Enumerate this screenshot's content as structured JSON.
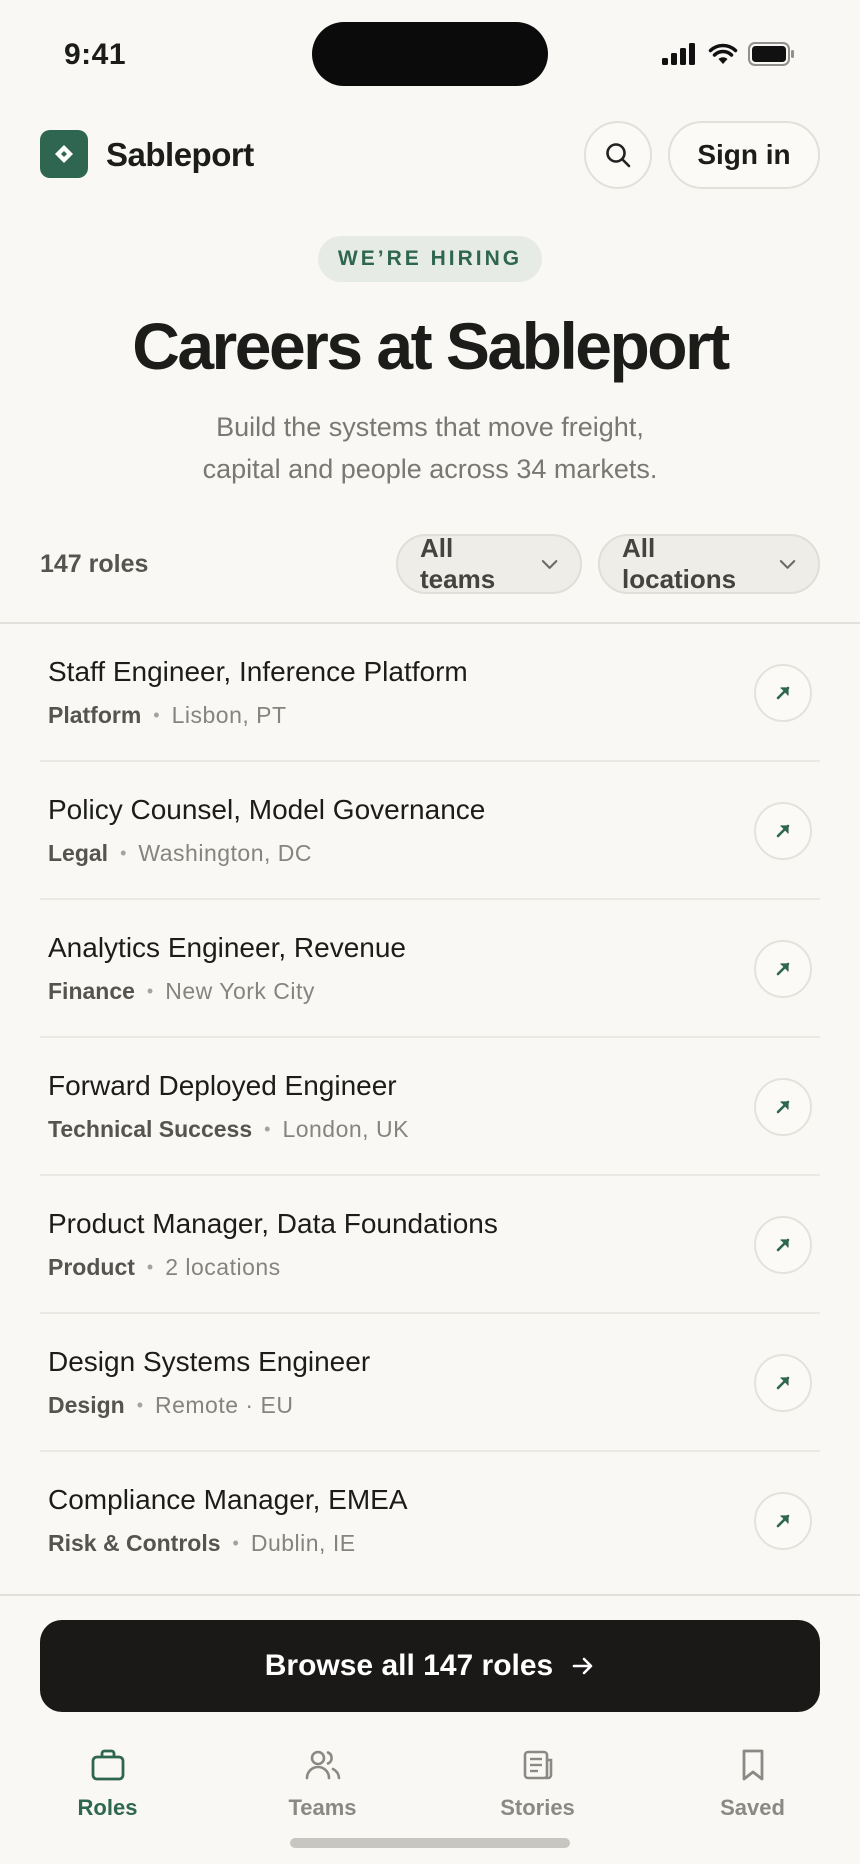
{
  "status_bar": {
    "time": "9:41"
  },
  "header": {
    "brand": "Sableport",
    "sign_in_label": "Sign in",
    "search_icon": "search-icon"
  },
  "hero": {
    "badge": "WE’RE HIRING",
    "title": "Careers at Sableport",
    "subtitle_line1": "Build the systems that move freight,",
    "subtitle_line2": "capital and people across 34 markets."
  },
  "filters": {
    "count": "147 roles",
    "teams": "All teams",
    "locations": "All locations"
  },
  "roles": [
    {
      "title": "Staff Engineer, Inference Platform",
      "team": "Platform",
      "location": "Lisbon, PT"
    },
    {
      "title": "Policy Counsel, Model Governance",
      "team": "Legal",
      "location": "Washington, DC"
    },
    {
      "title": "Analytics Engineer, Revenue",
      "team": "Finance",
      "location": "New York City"
    },
    {
      "title": "Forward Deployed Engineer",
      "team": "Technical Success",
      "location": "London, UK"
    },
    {
      "title": "Product Manager, Data Foundations",
      "team": "Product",
      "location": "2 locations"
    },
    {
      "title": "Design Systems Engineer",
      "team": "Design",
      "location": "Remote · EU"
    },
    {
      "title": "Compliance Manager, EMEA",
      "team": "Risk & Controls",
      "location": "Dublin, IE"
    }
  ],
  "cta": {
    "label": "Browse all 147 roles"
  },
  "tabs": [
    {
      "label": "Roles",
      "icon": "briefcase-icon",
      "active": true
    },
    {
      "label": "Teams",
      "icon": "people-icon",
      "active": false
    },
    {
      "label": "Stories",
      "icon": "newspaper-icon",
      "active": false
    },
    {
      "label": "Saved",
      "icon": "bookmark-icon",
      "active": false
    }
  ],
  "colors": {
    "accent": "#2f6651",
    "cta_bg": "#1a1918",
    "background": "#f9f8f5"
  }
}
